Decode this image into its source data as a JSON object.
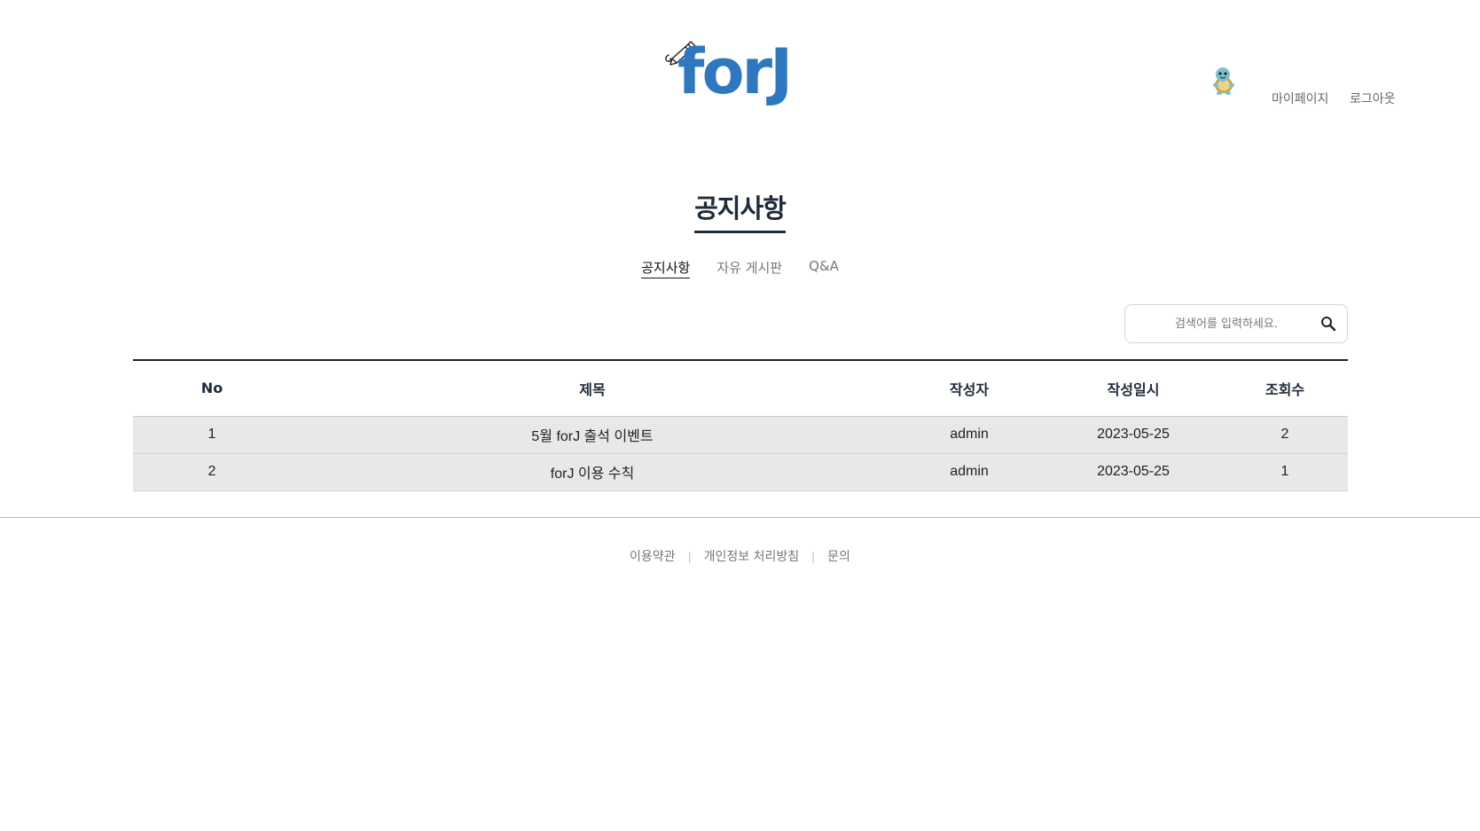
{
  "header": {
    "logo_text": "forJ",
    "mypage_label": "마이페이지",
    "logout_label": "로그아웃"
  },
  "page_title": "공지사항",
  "tabs": [
    {
      "label": "공지사항",
      "active": true
    },
    {
      "label": "자유 게시판",
      "active": false
    },
    {
      "label": "Q&A",
      "active": false
    }
  ],
  "search": {
    "placeholder": "검색어를 입력하세요.",
    "icon": "search-icon"
  },
  "table": {
    "columns": [
      "No",
      "제목",
      "작성자",
      "작성일시",
      "조회수"
    ],
    "rows": [
      {
        "no": "1",
        "title": "5월 forJ 출석 이벤트",
        "author": "admin",
        "date": "2023-05-25",
        "views": "2"
      },
      {
        "no": "2",
        "title": "forJ 이용 수칙",
        "author": "admin",
        "date": "2023-05-25",
        "views": "1"
      }
    ]
  },
  "footer": {
    "links": [
      "이용약관",
      "개인정보 처리방침",
      "문의"
    ]
  },
  "colors": {
    "brand": "#2f78bf",
    "title": "#1f2b3a",
    "row_background": "#e8e8e8"
  }
}
